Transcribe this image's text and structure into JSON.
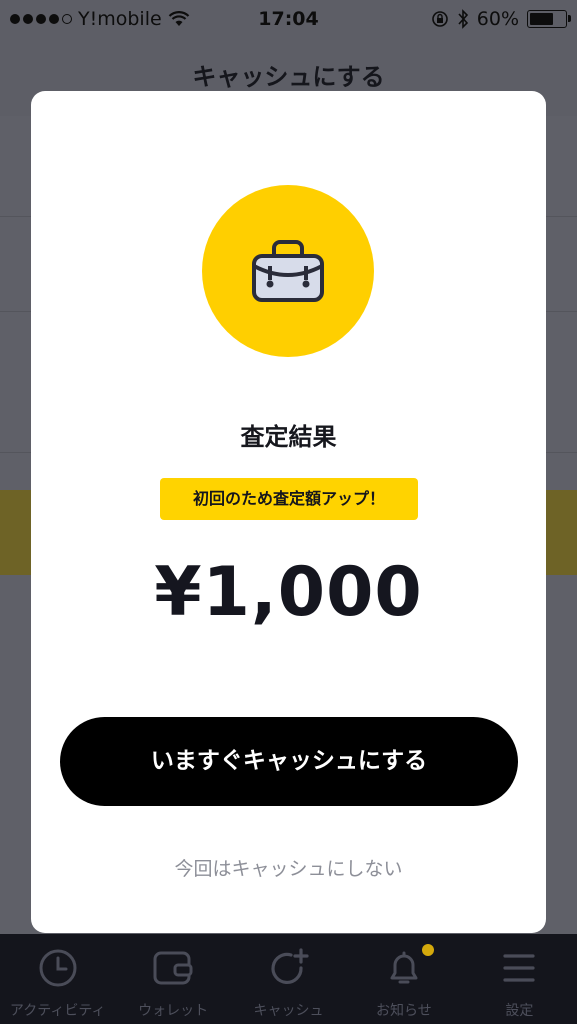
{
  "status_bar": {
    "carrier": "Y!mobile",
    "time": "17:04",
    "battery_percent": "60%",
    "battery_level": 0.6
  },
  "nav": {
    "title": "キャッシュにする"
  },
  "modal": {
    "icon": "bag-icon",
    "title": "査定結果",
    "promo": "初回のため査定額アップ！",
    "amount": "¥1,000",
    "primary_button": "いますぐキャッシュにする",
    "secondary_link": "今回はキャッシュにしない"
  },
  "tab_bar": {
    "items": [
      {
        "label": "アクティビティ",
        "icon": "clock-icon"
      },
      {
        "label": "ウォレット",
        "icon": "wallet-icon"
      },
      {
        "label": "キャッシュ",
        "icon": "cash-refresh-icon"
      },
      {
        "label": "お知らせ",
        "icon": "bell-icon"
      },
      {
        "label": "設定",
        "icon": "menu-icon"
      }
    ]
  },
  "colors": {
    "accent_yellow": "#ffcf00",
    "button_black": "#000000",
    "overlay_gray": "#5b5c64"
  }
}
